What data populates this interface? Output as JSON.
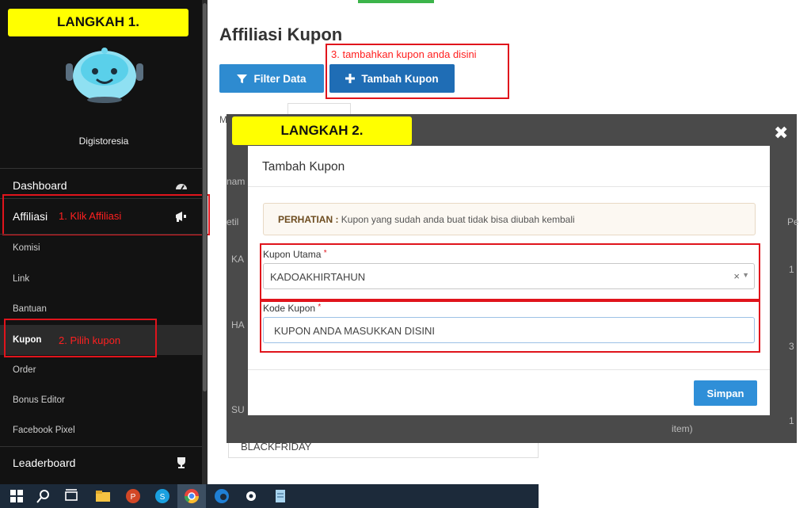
{
  "steps": {
    "step1": "LANGKAH 1.",
    "step2": "LANGKAH 2."
  },
  "sidebar": {
    "brand": "Digistoresia",
    "dashboard": "Dashboard",
    "affiliasi": "Affiliasi",
    "items": [
      "Komisi",
      "Link",
      "Bantuan",
      "Kupon",
      "Order",
      "Bonus Editor",
      "Facebook Pixel"
    ],
    "leaderboard": "Leaderboard"
  },
  "annotations": {
    "klik_affiliasi": "1. Klik Affiliasi",
    "pilih_kupon": "2. Pilih kupon",
    "tambahkan": "3. tambahkan kupon anda disini"
  },
  "main": {
    "title": "Affiliasi Kupon",
    "filter_button": "Filter Data",
    "tambah_button": "Tambah Kupon",
    "bg_blackfriday": "BLACKFRIDAY"
  },
  "modal": {
    "title": "Tambah Kupon",
    "alert_bold": "PERHATIAN :",
    "alert_text": " Kupon yang sudah anda buat tidak bisa diubah kembali",
    "kupon_utama_label": "Kupon Utama",
    "kupon_utama_value": "KADOAKHIRTAHUN",
    "kode_kupon_label": "Kode Kupon",
    "kode_kupon_value": "KUPON ANDA MASUKKAN DISINI",
    "required_mark": "*",
    "save_button": "Simpan",
    "close": "✖"
  },
  "colors": {
    "accent": "#2e8bd0",
    "highlight": "#ffff00",
    "annotation": "#e0141c",
    "sidebar_bg": "#121212"
  }
}
